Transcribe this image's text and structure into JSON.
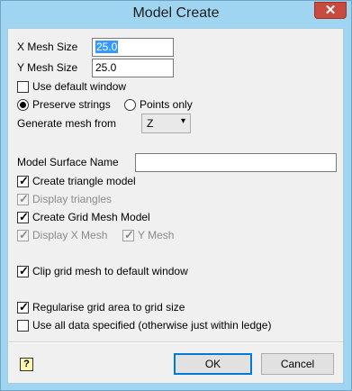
{
  "window": {
    "title": "Model Create",
    "close_label": "✕"
  },
  "form": {
    "x_mesh_size": {
      "label": "X Mesh Size",
      "value": "25.0"
    },
    "y_mesh_size": {
      "label": "Y Mesh Size",
      "value": "25.0"
    },
    "use_default_window": {
      "label": "Use default window",
      "checked": false
    },
    "preserve_strings": {
      "label": "Preserve strings",
      "selected": true
    },
    "points_only": {
      "label": "Points only",
      "selected": false
    },
    "generate_mesh_from": {
      "label": "Generate mesh from",
      "value": "Z",
      "arrow": "▾"
    },
    "model_surface_name": {
      "label": "Model Surface Name",
      "value": ""
    },
    "create_triangle_model": {
      "label": "Create triangle model",
      "checked": true
    },
    "display_triangles": {
      "label": "Display triangles",
      "checked": true,
      "enabled": false
    },
    "create_grid_mesh_model": {
      "label": "Create Grid Mesh Model",
      "checked": true
    },
    "display_x_mesh": {
      "label": "Display X Mesh",
      "checked": true,
      "enabled": false
    },
    "y_mesh": {
      "label": "Y Mesh",
      "checked": true,
      "enabled": false
    },
    "clip_grid_mesh": {
      "label": "Clip grid mesh to default window",
      "checked": true
    },
    "regularise_grid_area": {
      "label": "Regularise grid area to grid size",
      "checked": true
    },
    "use_all_data": {
      "label": "Use all data specified (otherwise just within ledge)",
      "checked": false
    }
  },
  "buttons": {
    "ok": "OK",
    "cancel": "Cancel",
    "help_glyph": "?"
  },
  "check_glyph": "✓"
}
